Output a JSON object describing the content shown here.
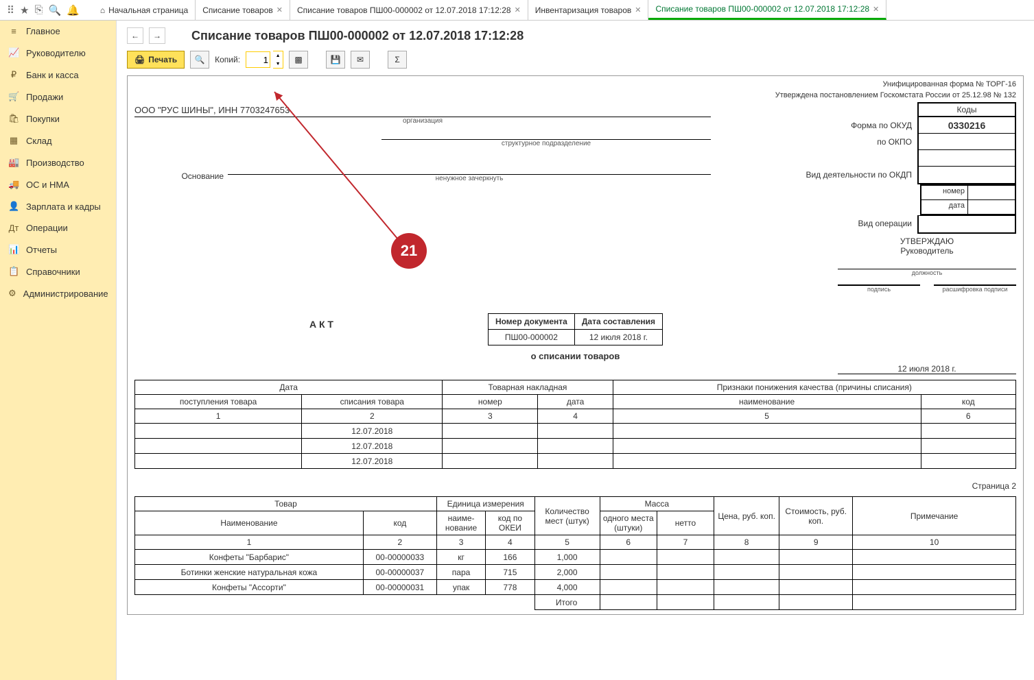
{
  "topbar": {
    "icons": [
      "apps",
      "star",
      "pin",
      "search",
      "bell"
    ]
  },
  "tabs": [
    {
      "label": "Начальная страница",
      "closable": false,
      "home": true
    },
    {
      "label": "Списание товаров",
      "closable": true
    },
    {
      "label": "Списание товаров ПШ00-000002 от 12.07.2018 17:12:28",
      "closable": true
    },
    {
      "label": "Инвентаризация товаров",
      "closable": true
    },
    {
      "label": "Списание товаров ПШ00-000002 от 12.07.2018 17:12:28",
      "closable": true,
      "active": true
    }
  ],
  "sidebar": [
    {
      "icon": "≡",
      "label": "Главное"
    },
    {
      "icon": "📈",
      "label": "Руководителю"
    },
    {
      "icon": "₽",
      "label": "Банк и касса"
    },
    {
      "icon": "🛒",
      "label": "Продажи"
    },
    {
      "icon": "🛍",
      "label": "Покупки"
    },
    {
      "icon": "▦",
      "label": "Склад"
    },
    {
      "icon": "🏭",
      "label": "Производство"
    },
    {
      "icon": "🚚",
      "label": "ОС и НМА"
    },
    {
      "icon": "👤",
      "label": "Зарплата и кадры"
    },
    {
      "icon": "Дт",
      "label": "Операции"
    },
    {
      "icon": "📊",
      "label": "Отчеты"
    },
    {
      "icon": "📋",
      "label": "Справочники"
    },
    {
      "icon": "⚙",
      "label": "Администрирование"
    }
  ],
  "page": {
    "title": "Списание товаров ПШ00-000002 от 12.07.2018 17:12:28",
    "print_btn": "Печать",
    "copies_label": "Копий:",
    "copies_value": "1",
    "marker": "21"
  },
  "form": {
    "header1": "Унифицированная форма № ТОРГ-16",
    "header2": "Утверждена постановлением Госкомстата России от 25.12.98 № 132",
    "codes_header": "Коды",
    "okud_label": "Форма по ОКУД",
    "okud": "0330216",
    "okpo_label": "по ОКПО",
    "okdp_label": "Вид деятельности по ОКДП",
    "number_label": "номер",
    "date_label": "дата",
    "oper_label": "Вид операции",
    "org": "ООО \"РУС ШИНЫ\", ИНН 7703247653",
    "org_caption": "организация",
    "dept_caption": "структурное подразделение",
    "basis_label": "Основание",
    "basis_caption": "ненужное зачеркнуть",
    "approve": "УТВЕРЖДАЮ",
    "approve_role": "Руководитель",
    "approve_pos": "должность",
    "approve_sign": "подпись",
    "approve_name": "расшифровка подписи",
    "akt": "А К Т",
    "akt_sub": "о списании товаров",
    "docnum_hdr": "Номер документа",
    "docdate_hdr": "Дата составления",
    "docnum": "ПШ00-000002",
    "docdate": "12 июля 2018 г.",
    "top_date": "12 июля 2018 г."
  },
  "table1": {
    "hdr_date": "Дата",
    "hdr_receipt": "поступления товара",
    "hdr_writeoff": "списания товара",
    "hdr_invoice": "Товарная накладная",
    "hdr_num": "номер",
    "hdr_idate": "дата",
    "hdr_reason": "Признаки понижения качества (причины списания)",
    "hdr_name": "наименование",
    "hdr_code": "код",
    "cols": [
      "1",
      "2",
      "3",
      "4",
      "5",
      "6"
    ],
    "rows": [
      {
        "writeoff": "12.07.2018"
      },
      {
        "writeoff": "12.07.2018"
      },
      {
        "writeoff": "12.07.2018"
      }
    ]
  },
  "page2_label": "Страница 2",
  "table2": {
    "hdr_goods": "Товар",
    "hdr_name": "Наименование",
    "hdr_code": "код",
    "hdr_unit": "Единица измерения",
    "hdr_unit_name": "наиме-нование",
    "hdr_okei": "код по ОКЕИ",
    "hdr_qty": "Количество мест (штук)",
    "hdr_mass": "Масса",
    "hdr_one": "одного места (штуки)",
    "hdr_net": "нетто",
    "hdr_price": "Цена, руб. коп.",
    "hdr_cost": "Стоимость, руб. коп.",
    "hdr_note": "Примечание",
    "cols": [
      "1",
      "2",
      "3",
      "4",
      "5",
      "6",
      "7",
      "8",
      "9",
      "10"
    ],
    "rows": [
      {
        "name": "Конфеты \"Барбарис\"",
        "code": "00-00000033",
        "unit": "кг",
        "okei": "166",
        "qty": "1,000"
      },
      {
        "name": "Ботинки женские натуральная кожа",
        "code": "00-00000037",
        "unit": "пара",
        "okei": "715",
        "qty": "2,000"
      },
      {
        "name": "Конфеты \"Ассорти\"",
        "code": "00-00000031",
        "unit": "упак",
        "okei": "778",
        "qty": "4,000"
      }
    ],
    "total": "Итого"
  }
}
